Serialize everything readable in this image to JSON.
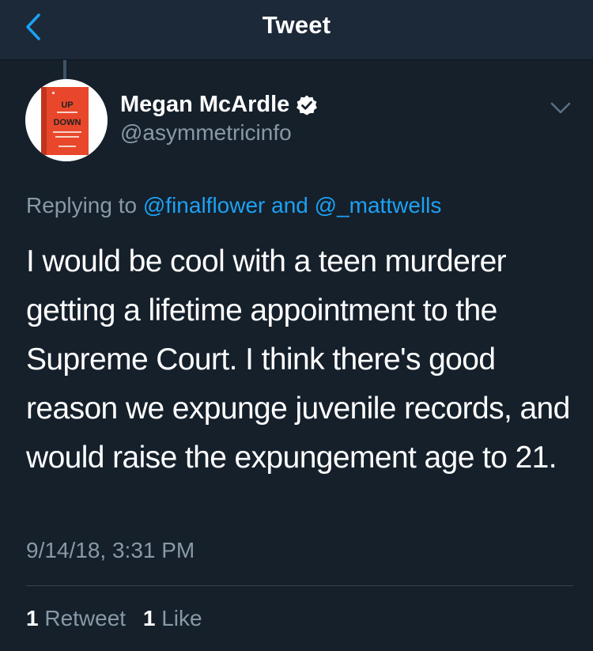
{
  "navbar": {
    "title": "Tweet",
    "back_icon": "chevron-left-icon"
  },
  "author": {
    "name": "Megan McArdle",
    "handle": "@asymmetricinfo",
    "verified_icon": "verified-badge-icon",
    "avatar_book": {
      "line1": "UP",
      "line2": "DOWN"
    }
  },
  "reply": {
    "prefix": "Replying to",
    "user1": "@finalflower",
    "joiner": "and",
    "user2": "@_mattwells"
  },
  "tweet": {
    "text": "I would be cool with a teen murderer getting a lifetime appointment to the Supreme Court. I think there's good reason we expunge juvenile records, and would raise the expungement age to 21.",
    "timestamp": "9/14/18, 3:31 PM"
  },
  "stats": {
    "retweets_count": "1",
    "retweets_label": "Retweet",
    "likes_count": "1",
    "likes_label": "Like"
  },
  "colors": {
    "background": "#15202b",
    "navbar": "#1c2938",
    "accent": "#1da1f2",
    "secondary_text": "#8899a6"
  }
}
